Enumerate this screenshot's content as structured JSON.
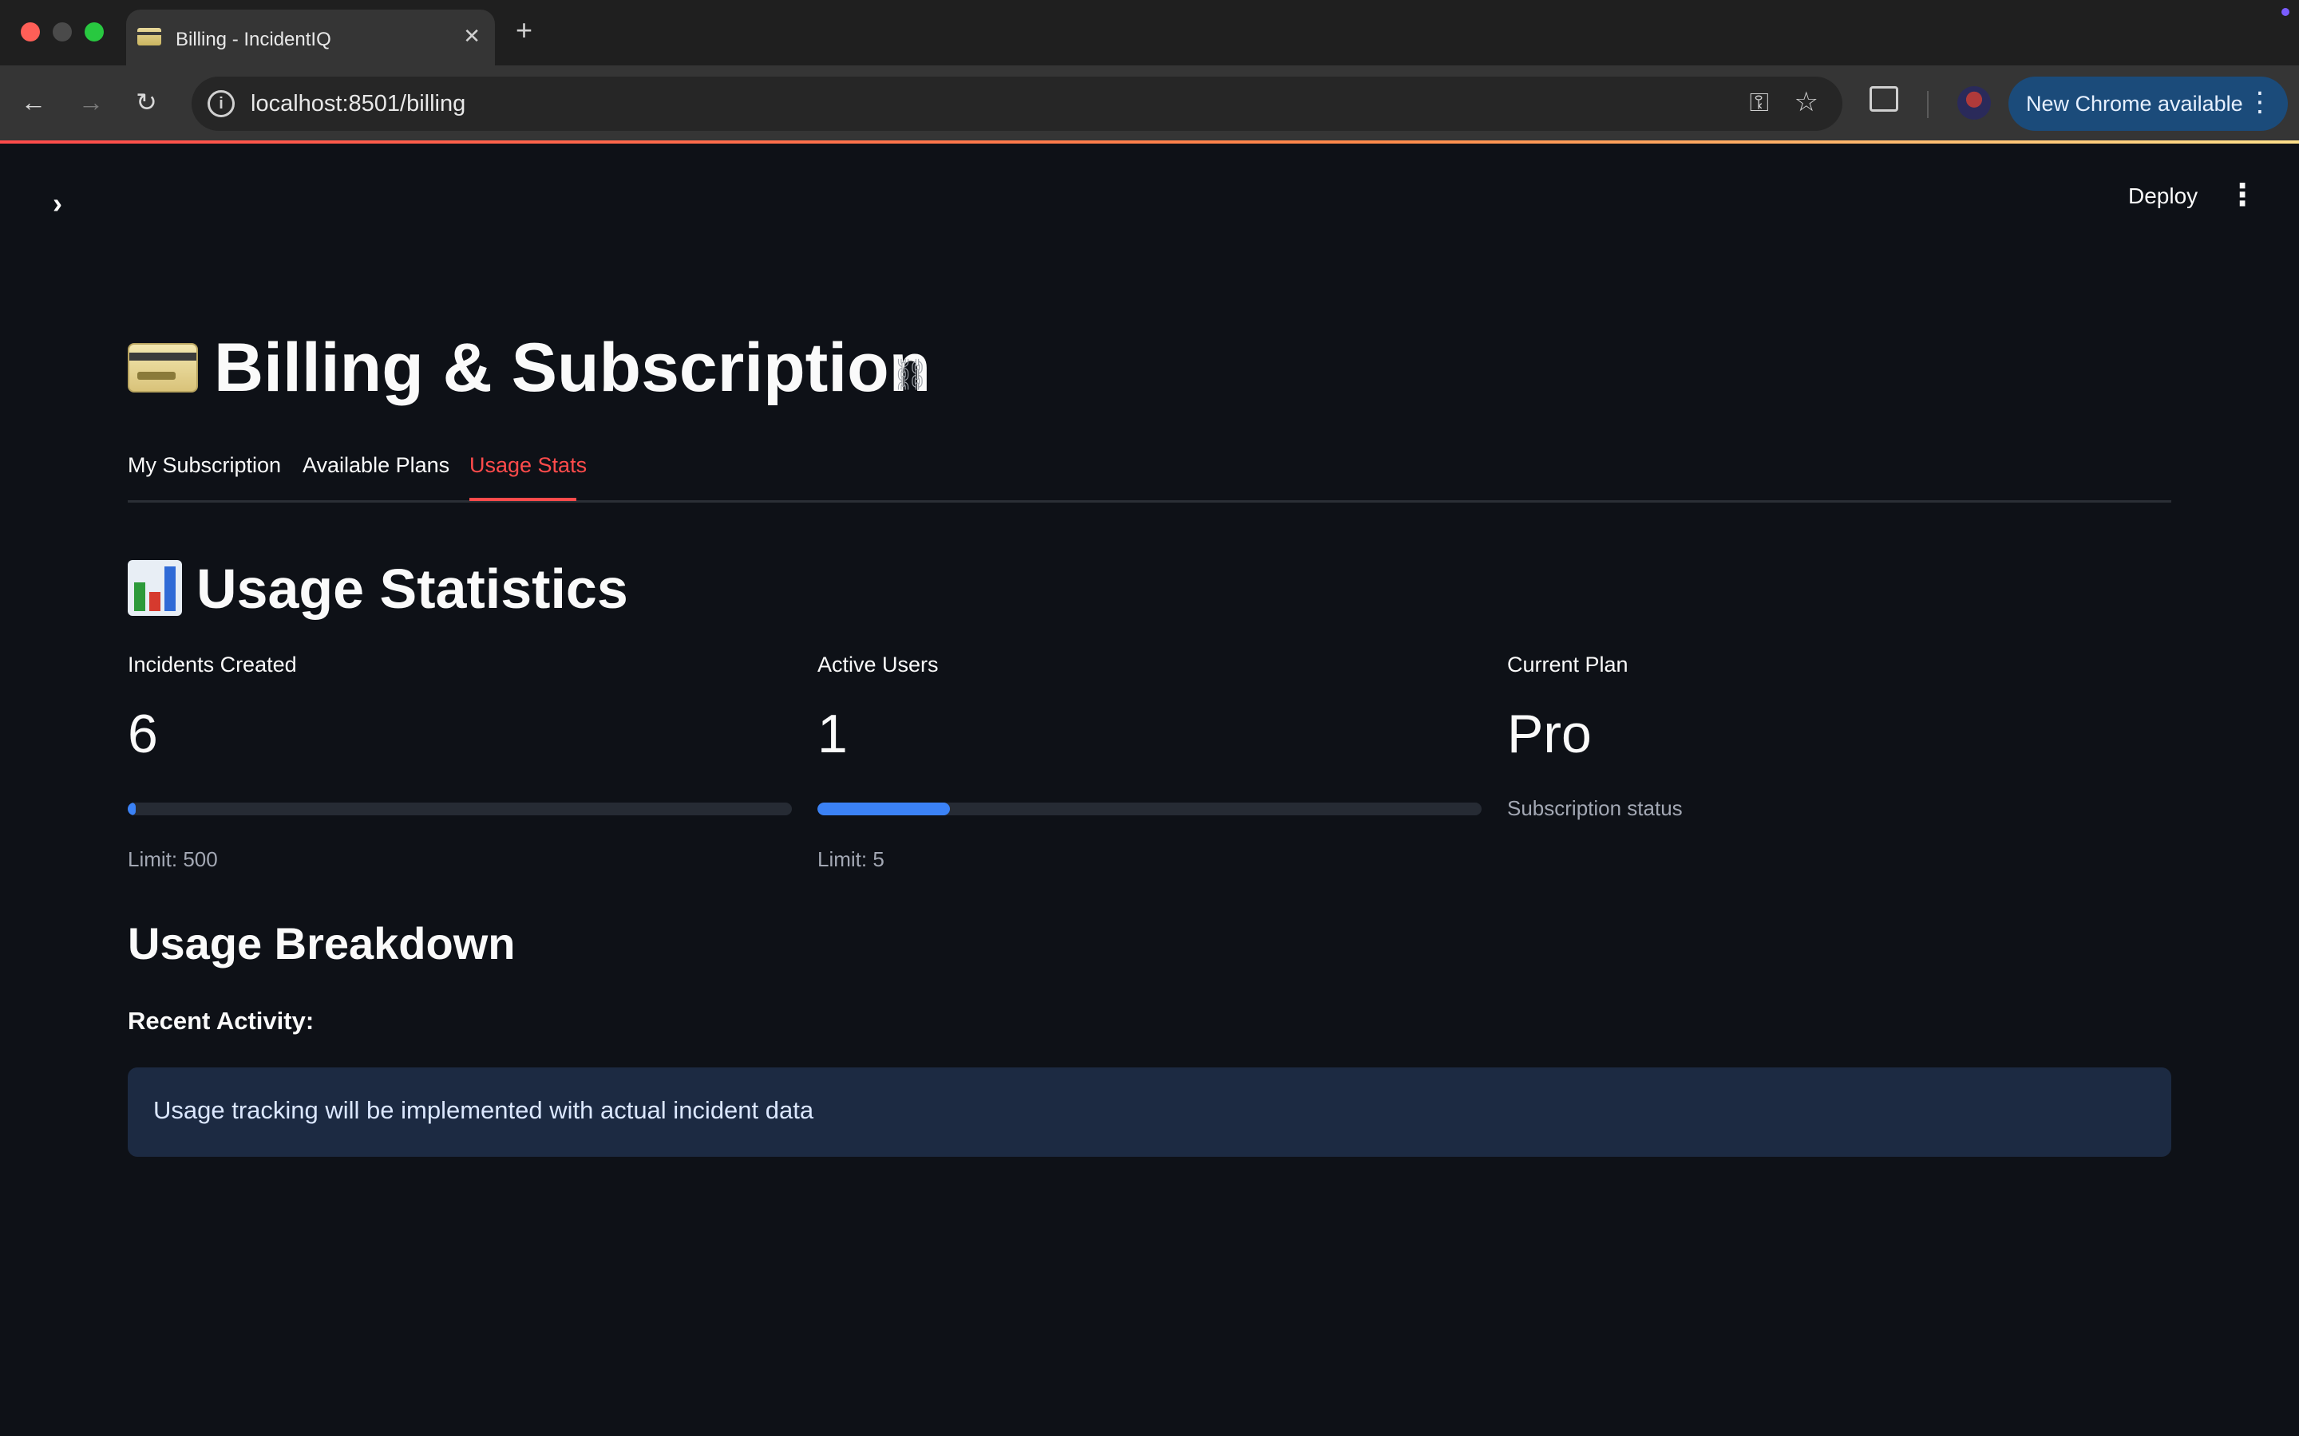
{
  "browser": {
    "tab_title": "Billing - IncidentIQ",
    "url": "localhost:8501/billing",
    "update_label": "New Chrome available"
  },
  "app": {
    "deploy_label": "Deploy",
    "page_title": "Billing & Subscription",
    "tabs": [
      {
        "label": "My Subscription",
        "active": false
      },
      {
        "label": "Available Plans",
        "active": false
      },
      {
        "label": "Usage Stats",
        "active": true
      }
    ],
    "section_title": "Usage Statistics",
    "metrics": [
      {
        "label": "Incidents Created",
        "value": "6",
        "caption": "Limit: 500",
        "progress": 0.012
      },
      {
        "label": "Active Users",
        "value": "1",
        "caption": "Limit: 5",
        "progress": 0.2
      },
      {
        "label": "Current Plan",
        "value": "Pro",
        "caption": "Subscription status"
      }
    ],
    "breakdown_title": "Usage Breakdown",
    "activity_label": "Recent Activity:",
    "info_message": "Usage tracking will be implemented with actual incident data"
  },
  "colors": {
    "accent": "#ff4b4b",
    "progress_fill": "#3b82f6",
    "background": "#0e1117",
    "info_bg": "#1c2a42"
  },
  "icons": {
    "page_title_emoji": "credit-card-icon",
    "section_emoji": "bar-chart-icon"
  }
}
